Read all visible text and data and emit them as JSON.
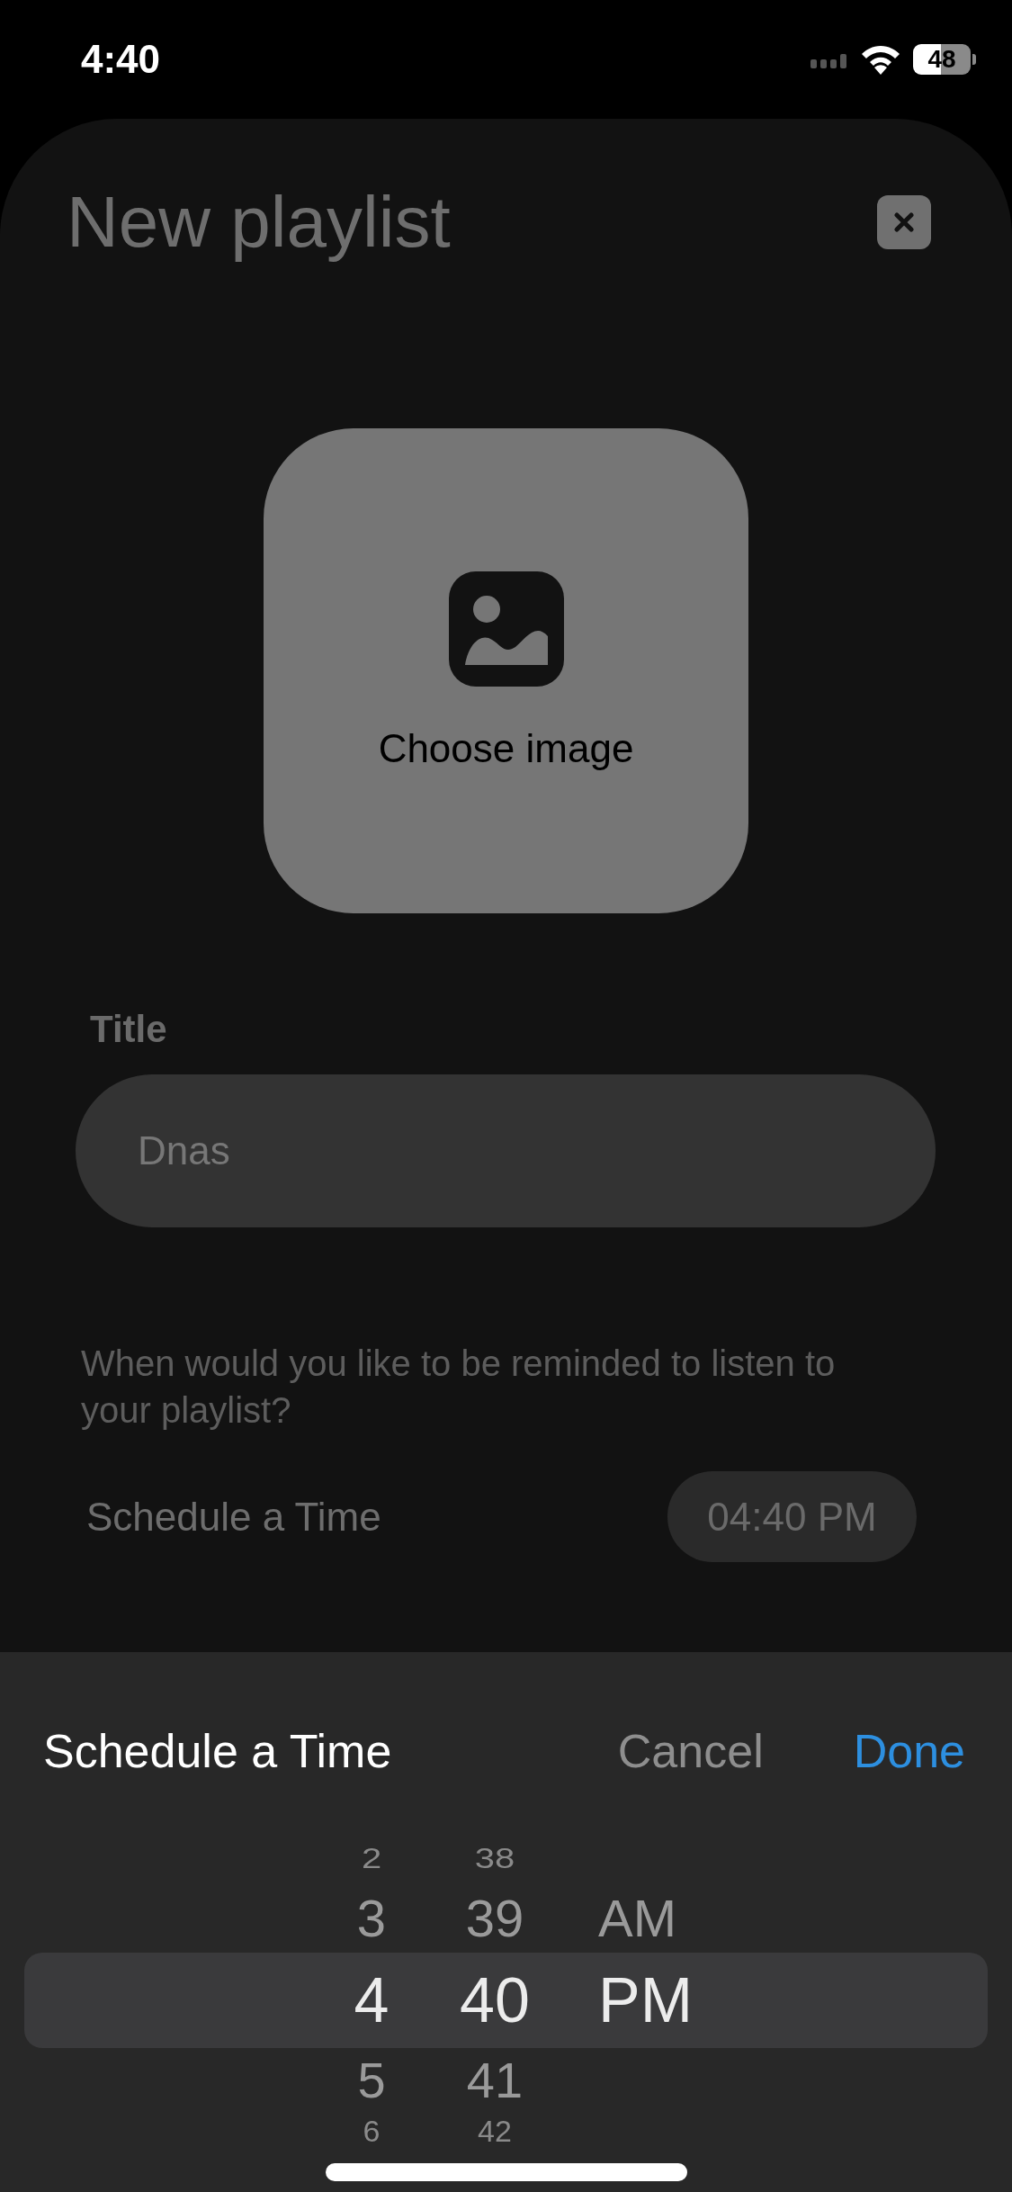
{
  "status_bar": {
    "time": "4:40",
    "battery": "48"
  },
  "sheet": {
    "title": "New playlist",
    "image_button": {
      "label": "Choose image"
    },
    "title_field": {
      "label": "Title",
      "value": "Dnas"
    },
    "reminder_prompt": "When would you like to be reminded to listen to your playlist?",
    "schedule_row": {
      "label": "Schedule a Time",
      "value": "04:40 PM"
    }
  },
  "time_picker": {
    "title": "Schedule a Time",
    "cancel": "Cancel",
    "done": "Done",
    "columns": [
      {
        "kind": "hour",
        "items": [
          {
            "label": "2",
            "selected": false
          },
          {
            "label": "3",
            "selected": false
          },
          {
            "label": "4",
            "selected": true
          },
          {
            "label": "5",
            "selected": false
          },
          {
            "label": "6",
            "selected": false
          }
        ]
      },
      {
        "kind": "minute",
        "items": [
          {
            "label": "38",
            "selected": false
          },
          {
            "label": "39",
            "selected": false
          },
          {
            "label": "40",
            "selected": true
          },
          {
            "label": "41",
            "selected": false
          },
          {
            "label": "42",
            "selected": false
          }
        ]
      },
      {
        "kind": "period",
        "items": [
          {
            "label": "AM",
            "selected": false
          },
          {
            "label": "PM",
            "selected": true
          }
        ]
      }
    ]
  }
}
